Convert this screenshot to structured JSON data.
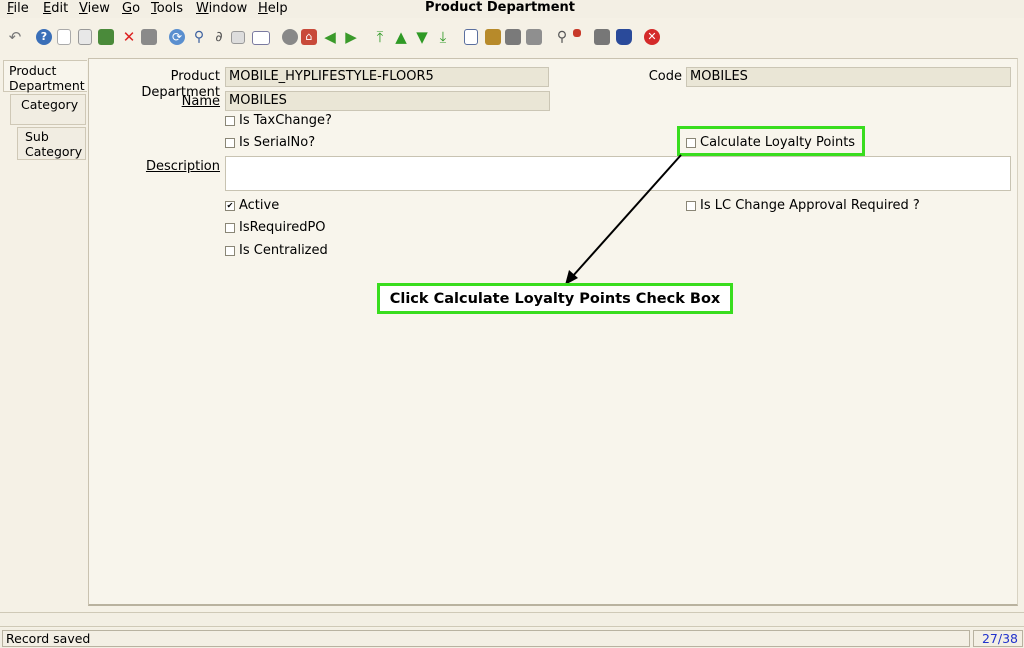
{
  "menu": {
    "items": [
      {
        "label": "File"
      },
      {
        "label": "Edit"
      },
      {
        "label": "View"
      },
      {
        "label": "Go"
      },
      {
        "label": "Tools"
      },
      {
        "label": "Window"
      },
      {
        "label": "Help"
      }
    ]
  },
  "window": {
    "title": "Product Department"
  },
  "toolbar": {
    "icons": [
      "undo-icon",
      "help-icon",
      "new-icon",
      "copy-icon",
      "save-icon",
      "delete-icon",
      "print-preview-icon",
      "refresh-icon",
      "find-icon",
      "attachment-icon",
      "chat-icon",
      "history-icon",
      "report-icon",
      "home-icon",
      "back-icon",
      "forward-icon",
      "first-record-icon",
      "previous-record-icon",
      "next-record-icon",
      "last-record-icon",
      "archive-icon",
      "detail-icon",
      "print-icon",
      "print-alt-icon",
      "zoom-icon",
      "workflow-icon",
      "process-icon",
      "database-icon",
      "close-icon"
    ]
  },
  "side_tabs": [
    {
      "line1": "Product",
      "line2": "Department"
    },
    {
      "line1": "Category",
      "line2": ""
    },
    {
      "line1": "Sub",
      "line2": "Category"
    }
  ],
  "form": {
    "product_department": {
      "label": "Product Department",
      "value": "MOBILE_HYPLIFESTYLE-FLOOR5"
    },
    "code": {
      "label": "Code",
      "value": "MOBILES"
    },
    "name": {
      "label": "Name",
      "value": "MOBILES"
    },
    "description": {
      "label": "Description",
      "value": ""
    },
    "checkboxes": {
      "is_tax_change": {
        "label": "Is TaxChange?",
        "checked": false
      },
      "is_serial_no": {
        "label": "Is SerialNo?",
        "checked": false
      },
      "calculate_loyalty_points": {
        "label": "Calculate Loyalty Points",
        "checked": false
      },
      "active": {
        "label": "Active",
        "checked": true,
        "mark": "✔"
      },
      "is_lc_change_approval_required": {
        "label": "Is LC Change Approval Required ?",
        "checked": false
      },
      "is_required_po": {
        "label": "IsRequiredPO",
        "checked": false
      },
      "is_centralized": {
        "label": "Is Centralized",
        "checked": false
      }
    }
  },
  "annotation": {
    "callout_text": "Click Calculate Loyalty Points Check Box",
    "highlight_color": "#39dd1e"
  },
  "status": {
    "message": "Record saved",
    "record_counter": "27/38"
  }
}
